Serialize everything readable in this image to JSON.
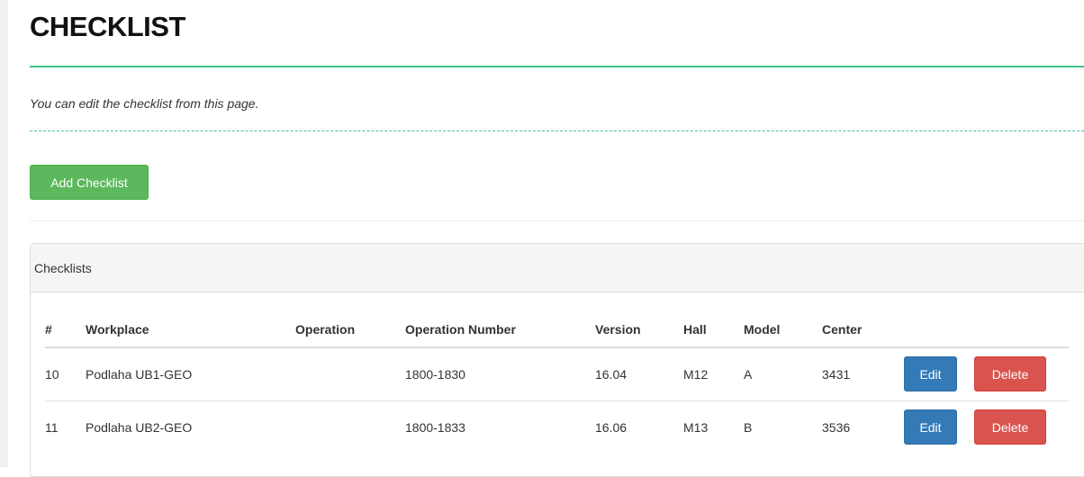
{
  "header": {
    "title": "CHECKLIST",
    "subtitle": "You can edit the checklist from this page."
  },
  "toolbar": {
    "add_label": "Add Checklist"
  },
  "panel": {
    "heading": "Checklists",
    "columns": [
      "#",
      "Workplace",
      "Operation",
      "Operation Number",
      "Version",
      "Hall",
      "Model",
      "Center"
    ],
    "rows": [
      {
        "id": "10",
        "workplace": "Podlaha UB1-GEO",
        "operation": "",
        "operation_number": "1800-1830",
        "version": "16.04",
        "hall": "M12",
        "model": "A",
        "center": "3431"
      },
      {
        "id": "11",
        "workplace": "Podlaha UB2-GEO",
        "operation": "",
        "operation_number": "1800-1833",
        "version": "16.06",
        "hall": "M13",
        "model": "B",
        "center": "3536"
      }
    ],
    "edit_label": "Edit",
    "delete_label": "Delete"
  },
  "colors": {
    "accent_rule": "#3fc488",
    "add_button": "#5cb85c",
    "edit_button": "#337ab7",
    "delete_button": "#d9534f"
  }
}
